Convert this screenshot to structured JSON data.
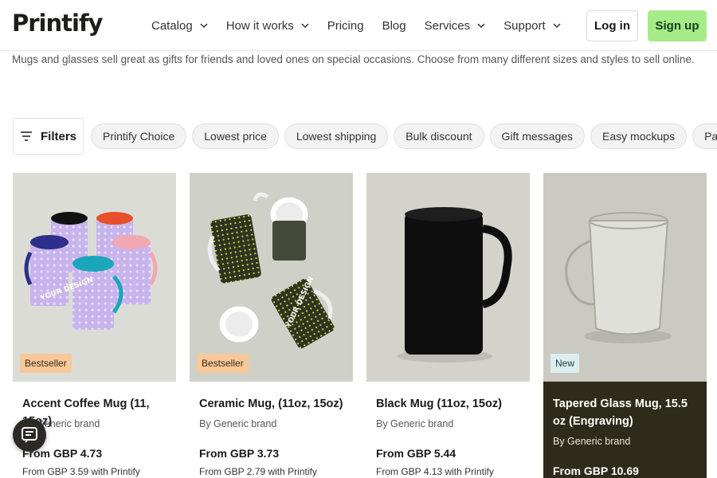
{
  "header": {
    "logo": "Printify",
    "nav": [
      {
        "label": "Catalog",
        "has_dropdown": true
      },
      {
        "label": "How it works",
        "has_dropdown": true
      },
      {
        "label": "Pricing",
        "has_dropdown": false
      },
      {
        "label": "Blog",
        "has_dropdown": false
      },
      {
        "label": "Services",
        "has_dropdown": true
      },
      {
        "label": "Support",
        "has_dropdown": true
      }
    ],
    "login_label": "Log in",
    "signup_label": "Sign up"
  },
  "intro": "Mugs and glasses sell great as gifts for friends and loved ones on special occasions. Choose from many different sizes and styles to sell online.",
  "filters": {
    "button_label": "Filters",
    "chips": [
      "Printify Choice",
      "Lowest price",
      "Lowest shipping",
      "Bulk discount",
      "Gift messages",
      "Easy mockups",
      "Packing inserts"
    ]
  },
  "products": [
    {
      "badge": "Bestseller",
      "title": "Accent Coffee Mug (11, 15oz)",
      "brand": "By Generic brand",
      "price": "From GBP 4.73",
      "sub_price": "From GBP 3.59 with Printify"
    },
    {
      "badge": "Bestseller",
      "title": "Ceramic Mug, (11oz, 15oz)",
      "brand": "By Generic brand",
      "price": "From GBP 3.73",
      "sub_price": "From GBP 2.79 with Printify"
    },
    {
      "badge": "",
      "title": "Black Mug (11oz, 15oz)",
      "brand": "By Generic brand",
      "price": "From GBP 5.44",
      "sub_price": "From GBP 4.13 with Printify"
    },
    {
      "badge": "New",
      "title": "Tapered Glass Mug, 15.5 oz (Engraving)",
      "brand": "By Generic brand",
      "price": "From GBP 10.69",
      "sub_price": ""
    }
  ],
  "mug_print_text": "YOUR DESIGN",
  "colors": {
    "signup_bg": "#a5ec88",
    "badge_bestseller": "#f7c899",
    "badge_new": "#dbeff0",
    "dark_card": "#2f2b1a"
  },
  "icons": {
    "filters": "sliders-icon",
    "chevron": "chevron-down-icon",
    "chat": "chat-icon"
  }
}
